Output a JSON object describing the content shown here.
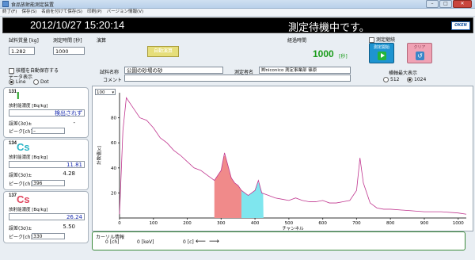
{
  "window": {
    "title": "食品放射能測定装置"
  },
  "menu": [
    "終了(F)",
    "保存(S)",
    "名前を付けて保存(S)",
    "印刷(P)",
    "バージョン情報(V)"
  ],
  "header": {
    "datetime": "2012/10/27 15:20:14",
    "status": "測定待機中です。",
    "logo": "OKEN"
  },
  "sample": {
    "mass_label": "試料質量 [kg]",
    "mass_value": "1.282",
    "time_label": "測定時間 [秒]",
    "time_value": "1000"
  },
  "calc": {
    "label": "演算",
    "button": "自動演算"
  },
  "elapsed": {
    "label": "経過時間",
    "value": "1000",
    "unit": "[秒]"
  },
  "controls": {
    "continuous_label": "測定継続",
    "start_label": "測定開始",
    "clear_label": "クリア"
  },
  "options": {
    "auto_save_label": "核種を自動保存する",
    "data_display_label": "データ表示",
    "line_label": "Line",
    "dot_label": "Dot"
  },
  "meta": {
    "sample_name_label": "試料名称",
    "sample_name_value": "公園の砂場の砂",
    "comment_label": "コメント",
    "operator_label": "測定者名",
    "operator_value": "㈱niconico 測定事業部  篠原"
  },
  "axis_max": {
    "label": "横軸最大表示",
    "opt1": "512",
    "opt2": "1024"
  },
  "i131": {
    "mass": "131",
    "symbol": "I",
    "conc_label": "放射能濃度 [Bq/kg]",
    "value": "検出されず",
    "error_label": "誤差(3σ)±",
    "error_value": "-",
    "peak_label": "ピーク[ch]",
    "peak_value": "–"
  },
  "cs134": {
    "mass": "134",
    "symbol": "Cs",
    "conc_label": "放射能濃度 [Bq/kg]",
    "value": "11.81",
    "error_label": "誤差(3σ)±",
    "error_value": "4.28",
    "peak_label": "ピーク[ch]",
    "peak_value": "396"
  },
  "cs137": {
    "mass": "137",
    "symbol": "Cs",
    "conc_label": "放射能濃度 [Bq/kg]",
    "value": "26.24",
    "error_label": "誤差(3σ)±",
    "error_value": "5.50",
    "peak_label": "ピーク[ch]",
    "peak_value": "330"
  },
  "cursor": {
    "title": "カーソル情報",
    "ch": "0 [ch]",
    "kev": "0 [keV]",
    "count": "0 [c]",
    "left_arrow": "⟵",
    "right_arrow": "⟶"
  },
  "chart_data": {
    "type": "line",
    "ymax_select": "100",
    "xlabel": "チャンネル",
    "ylabel": "計数値[c]",
    "xlim": [
      0,
      1024
    ],
    "ylim": [
      0,
      100
    ],
    "x_ticks": [
      0,
      100,
      200,
      300,
      400,
      500,
      600,
      700,
      800,
      900,
      1000
    ],
    "y_ticks": [
      20,
      40,
      60,
      80
    ],
    "series": [
      {
        "values_x": [
          0,
          10,
          20,
          40,
          60,
          80,
          100,
          120,
          140,
          160,
          180,
          200,
          220,
          240,
          260,
          280,
          300,
          310,
          320,
          330,
          340,
          350,
          360,
          380,
          400,
          410,
          420,
          440,
          460,
          480,
          500,
          520,
          540,
          560,
          580,
          600,
          620,
          640,
          660,
          680,
          700,
          710,
          720,
          740,
          760,
          780,
          800,
          850,
          900,
          950,
          1000,
          1024
        ],
        "values_y": [
          3,
          70,
          96,
          88,
          80,
          78,
          72,
          64,
          60,
          54,
          50,
          45,
          40,
          38,
          34,
          30,
          38,
          52,
          42,
          32,
          28,
          26,
          22,
          18,
          22,
          30,
          20,
          18,
          16,
          15,
          14,
          16,
          14,
          13,
          13,
          14,
          12,
          12,
          13,
          14,
          22,
          48,
          28,
          12,
          8,
          7,
          7,
          6,
          5,
          5,
          4,
          3
        ]
      }
    ],
    "highlight_regions": [
      {
        "name": "Cs-137",
        "range": [
          280,
          360
        ],
        "color": "#f08a8a"
      },
      {
        "name": "Cs-134",
        "range": [
          360,
          425
        ],
        "color": "#7fe6ee"
      }
    ],
    "line_color": "#c0368f"
  }
}
